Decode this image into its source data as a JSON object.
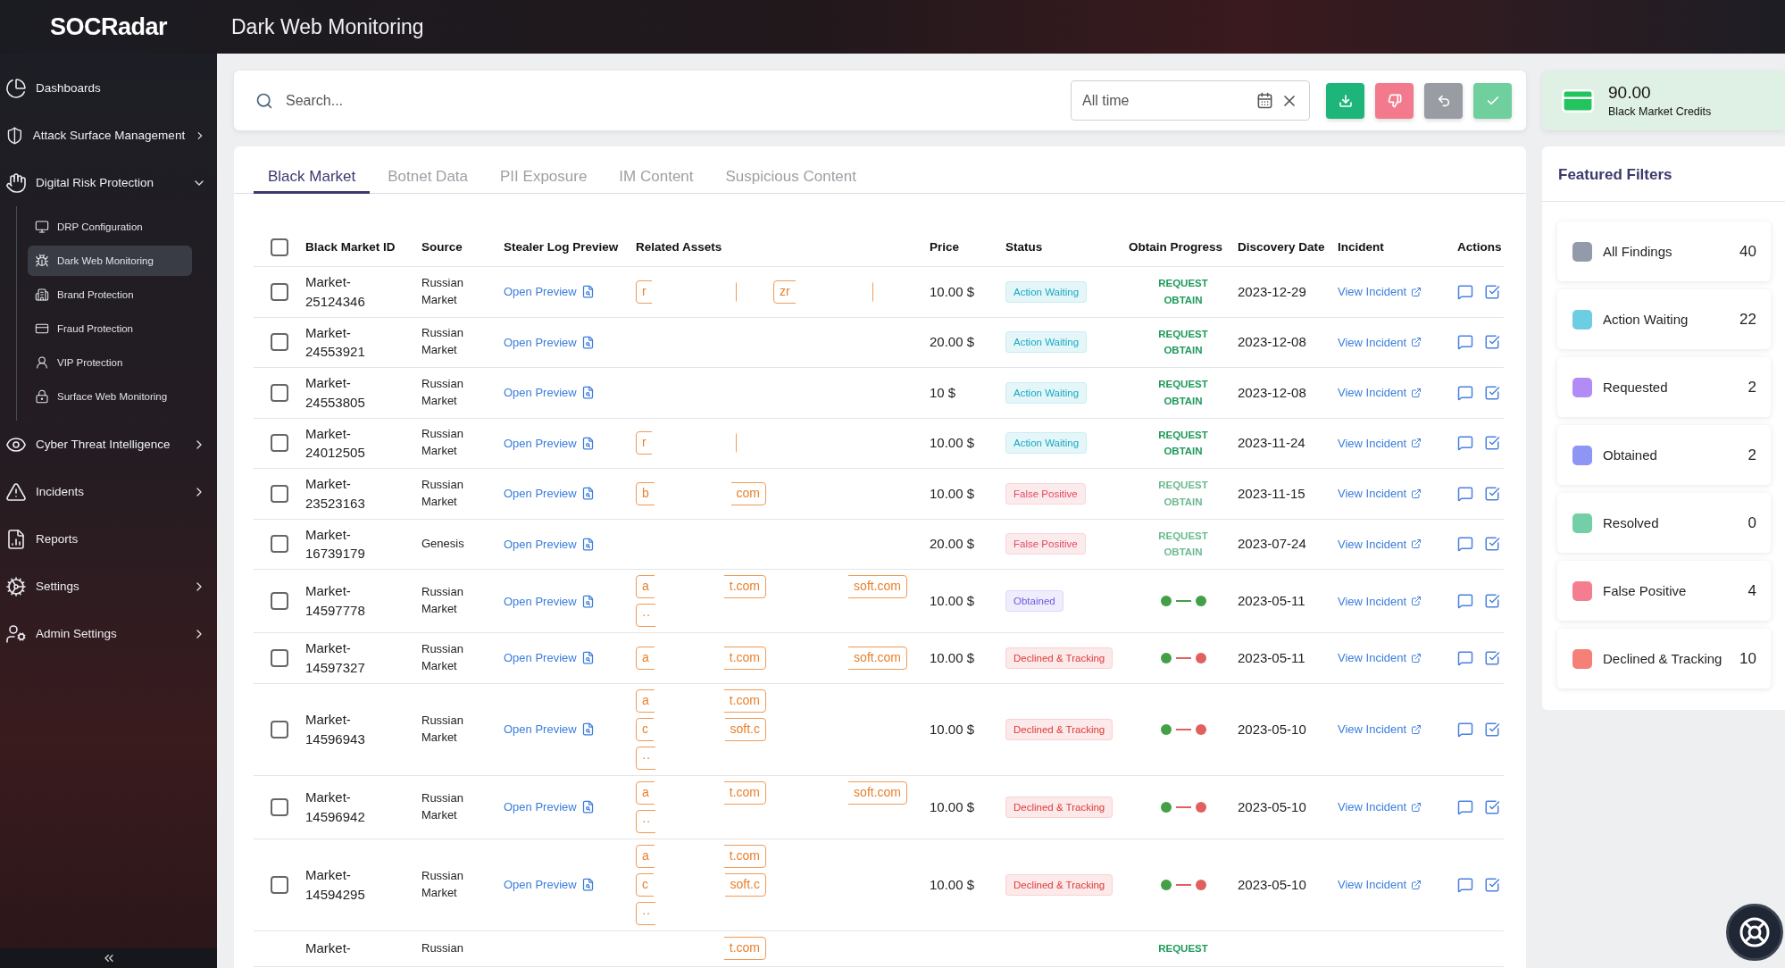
{
  "header": {
    "logo": "SOCRadar",
    "title": "Dark Web Monitoring"
  },
  "sidebar": {
    "items": [
      {
        "label": "Dashboards",
        "expandable": false,
        "expanded": false
      },
      {
        "label": "Attack Surface Management",
        "expandable": true,
        "expanded": false
      },
      {
        "label": "Digital Risk Protection",
        "expandable": true,
        "expanded": true,
        "children": [
          {
            "label": "DRP Configuration",
            "selected": false
          },
          {
            "label": "Dark Web Monitoring",
            "selected": true
          },
          {
            "label": "Brand Protection",
            "selected": false
          },
          {
            "label": "Fraud Protection",
            "selected": false
          },
          {
            "label": "VIP Protection",
            "selected": false
          },
          {
            "label": "Surface Web Monitoring",
            "selected": false
          }
        ]
      },
      {
        "label": "Cyber Threat Intelligence",
        "expandable": true,
        "expanded": false
      },
      {
        "label": "Incidents",
        "expandable": true,
        "expanded": false
      },
      {
        "label": "Reports",
        "expandable": false,
        "expanded": false
      },
      {
        "label": "Settings",
        "expandable": true,
        "expanded": false
      },
      {
        "label": "Admin Settings",
        "expandable": true,
        "expanded": false
      }
    ]
  },
  "search": {
    "placeholder": "Search...",
    "date_filter": "All time"
  },
  "toolbar_buttons": [
    {
      "kind": "download",
      "color": "#1db57a"
    },
    {
      "kind": "dislike",
      "color": "#f27a8c"
    },
    {
      "kind": "undo",
      "color": "#9a9ca3"
    },
    {
      "kind": "check",
      "color": "#6fcf9d"
    }
  ],
  "tabs": [
    {
      "label": "Black Market",
      "selected": true
    },
    {
      "label": "Botnet Data",
      "selected": false
    },
    {
      "label": "PII Exposure",
      "selected": false
    },
    {
      "label": "IM Content",
      "selected": false
    },
    {
      "label": "Suspicious Content",
      "selected": false
    }
  ],
  "table": {
    "select_all": {
      "checked": false
    },
    "columns": [
      "Black Market ID",
      "Source",
      "Stealer Log Preview",
      "Related Assets",
      "Price",
      "Status",
      "Obtain Progress",
      "Discovery Date",
      "Incident",
      "Actions"
    ],
    "rows": [
      {
        "checked": false,
        "id": [
          "Market-",
          "25124346"
        ],
        "source": [
          "Russian",
          "Market"
        ],
        "preview": "Open Preview",
        "assets_a": [
          {
            "start": "r"
          }
        ],
        "assets_b": [
          {
            "start": "zr"
          }
        ],
        "price": "10.00 $",
        "status": {
          "label": "Action Waiting",
          "color": "#15a9c4"
        },
        "progress": {
          "kind": "request",
          "lines": [
            "REQUEST",
            "OBTAIN"
          ],
          "muted": false
        },
        "date": "2023-12-29",
        "incident": "View Incident"
      },
      {
        "checked": false,
        "id": [
          "Market-",
          "24553921"
        ],
        "source": [
          "Russian",
          "Market"
        ],
        "preview": "Open Preview",
        "assets_a": [],
        "assets_b": [],
        "price": "20.00 $",
        "status": {
          "label": "Action Waiting",
          "color": "#15a9c4"
        },
        "progress": {
          "kind": "request",
          "lines": [
            "REQUEST",
            "OBTAIN"
          ],
          "muted": false
        },
        "date": "2023-12-08",
        "incident": "View Incident"
      },
      {
        "checked": false,
        "id": [
          "Market-",
          "24553805"
        ],
        "source": [
          "Russian",
          "Market"
        ],
        "preview": "Open Preview",
        "assets_a": [],
        "assets_b": [],
        "price": "10 $",
        "status": {
          "label": "Action Waiting",
          "color": "#15a9c4"
        },
        "progress": {
          "kind": "request",
          "lines": [
            "REQUEST",
            "OBTAIN"
          ],
          "muted": false
        },
        "date": "2023-12-08",
        "incident": "View Incident"
      },
      {
        "checked": false,
        "id": [
          "Market-",
          "24012505"
        ],
        "source": [
          "Russian",
          "Market"
        ],
        "preview": "Open Preview",
        "assets_a": [
          {
            "start": "r"
          }
        ],
        "assets_b": [],
        "price": "10.00 $",
        "status": {
          "label": "Action Waiting",
          "color": "#15a9c4"
        },
        "progress": {
          "kind": "request",
          "lines": [
            "REQUEST",
            "OBTAIN"
          ],
          "muted": false
        },
        "date": "2023-11-24",
        "incident": "View Incident"
      },
      {
        "checked": false,
        "id": [
          "Market-",
          "23523163"
        ],
        "source": [
          "Russian",
          "Market"
        ],
        "preview": "Open Preview",
        "assets_a": [
          {
            "start": "b",
            "end": "com"
          }
        ],
        "assets_b": [],
        "price": "10.00 $",
        "status": {
          "label": "False Positive",
          "color": "#e5485f"
        },
        "progress": {
          "kind": "request",
          "lines": [
            "REQUEST",
            "OBTAIN"
          ],
          "muted": true
        },
        "date": "2023-11-15",
        "incident": "View Incident"
      },
      {
        "checked": false,
        "id": [
          "Market-",
          "16739179"
        ],
        "source": [
          "Genesis"
        ],
        "preview": "Open Preview",
        "assets_a": [],
        "assets_b": [],
        "price": "20.00 $",
        "status": {
          "label": "False Positive",
          "color": "#e5485f"
        },
        "progress": {
          "kind": "request",
          "lines": [
            "REQUEST",
            "OBTAIN"
          ],
          "muted": true
        },
        "date": "2023-07-24",
        "incident": "View Incident"
      },
      {
        "checked": false,
        "id": [
          "Market-",
          "14597778"
        ],
        "source": [
          "Russian",
          "Market"
        ],
        "preview": "Open Preview",
        "assets_a": [
          {
            "start": "a",
            "end": "t.com"
          },
          {
            "start": "··"
          }
        ],
        "assets_b": [
          {
            "end": "soft.com"
          }
        ],
        "price": "10.00 $",
        "status": {
          "label": "Obtained",
          "color": "#6b5ce0"
        },
        "progress": {
          "kind": "dots",
          "dots": [
            {
              "color": "#43a047"
            },
            {
              "color": "#43a047"
            }
          ]
        },
        "date": "2023-05-11",
        "incident": "View Incident"
      },
      {
        "checked": false,
        "id": [
          "Market-",
          "14597327"
        ],
        "source": [
          "Russian",
          "Market"
        ],
        "preview": "Open Preview",
        "assets_a": [
          {
            "start": "a",
            "end": "t.com"
          }
        ],
        "assets_b": [
          {
            "end": "soft.com"
          }
        ],
        "price": "10.00 $",
        "status": {
          "label": "Declined & Tracking",
          "color": "#e03a3a"
        },
        "progress": {
          "kind": "dots",
          "dots": [
            {
              "color": "#43a047"
            },
            {
              "color": "#e06060"
            }
          ]
        },
        "date": "2023-05-11",
        "incident": "View Incident"
      },
      {
        "checked": false,
        "id": [
          "Market-",
          "14596943"
        ],
        "source": [
          "Russian",
          "Market"
        ],
        "preview": "Open Preview",
        "assets_a": [
          {
            "start": "a",
            "end": "t.com"
          },
          {
            "start": "c",
            "end": "soft.c"
          },
          {
            "start": "··"
          }
        ],
        "assets_b": [],
        "price": "10.00 $",
        "status": {
          "label": "Declined & Tracking",
          "color": "#e03a3a"
        },
        "progress": {
          "kind": "dots",
          "dots": [
            {
              "color": "#43a047"
            },
            {
              "color": "#e06060"
            }
          ]
        },
        "date": "2023-05-10",
        "incident": "View Incident"
      },
      {
        "checked": false,
        "id": [
          "Market-",
          "14596942"
        ],
        "source": [
          "Russian",
          "Market"
        ],
        "preview": "Open Preview",
        "assets_a": [
          {
            "start": "a",
            "end": "t.com"
          },
          {
            "start": "··"
          }
        ],
        "assets_b": [
          {
            "end": "soft.com"
          }
        ],
        "price": "10.00 $",
        "status": {
          "label": "Declined & Tracking",
          "color": "#e03a3a"
        },
        "progress": {
          "kind": "dots",
          "dots": [
            {
              "color": "#43a047"
            },
            {
              "color": "#e06060"
            }
          ]
        },
        "date": "2023-05-10",
        "incident": "View Incident"
      },
      {
        "checked": false,
        "id": [
          "Market-",
          "14594295"
        ],
        "source": [
          "Russian",
          "Market"
        ],
        "preview": "Open Preview",
        "assets_a": [
          {
            "start": "a",
            "end": "t.com"
          },
          {
            "start": "c",
            "end": "soft.c"
          },
          {
            "start": "··"
          }
        ],
        "assets_b": [],
        "price": "10.00 $",
        "status": {
          "label": "Declined & Tracking",
          "color": "#e03a3a"
        },
        "progress": {
          "kind": "dots",
          "dots": [
            {
              "color": "#43a047"
            },
            {
              "color": "#e06060"
            }
          ]
        },
        "date": "2023-05-10",
        "incident": "View Incident"
      }
    ],
    "partial_row": {
      "id": "Market-",
      "source": "Russian",
      "asset_end": "t.com",
      "progress": "REQUEST"
    }
  },
  "credits": {
    "amount": "90.00",
    "label": "Black Market Credits"
  },
  "featured_filters": {
    "title": "Featured Filters",
    "items": [
      {
        "label": "All Findings",
        "count": "40",
        "color": "#939aaa"
      },
      {
        "label": "Action Waiting",
        "count": "22",
        "color": "#6dcde3"
      },
      {
        "label": "Requested",
        "count": "2",
        "color": "#b18cf6"
      },
      {
        "label": "Obtained",
        "count": "2",
        "color": "#8e95f4"
      },
      {
        "label": "Resolved",
        "count": "0",
        "color": "#74cfa8"
      },
      {
        "label": "False Positive",
        "count": "4",
        "color": "#f47e90"
      },
      {
        "label": "Declined & Tracking",
        "count": "10",
        "color": "#f58078"
      }
    ]
  }
}
